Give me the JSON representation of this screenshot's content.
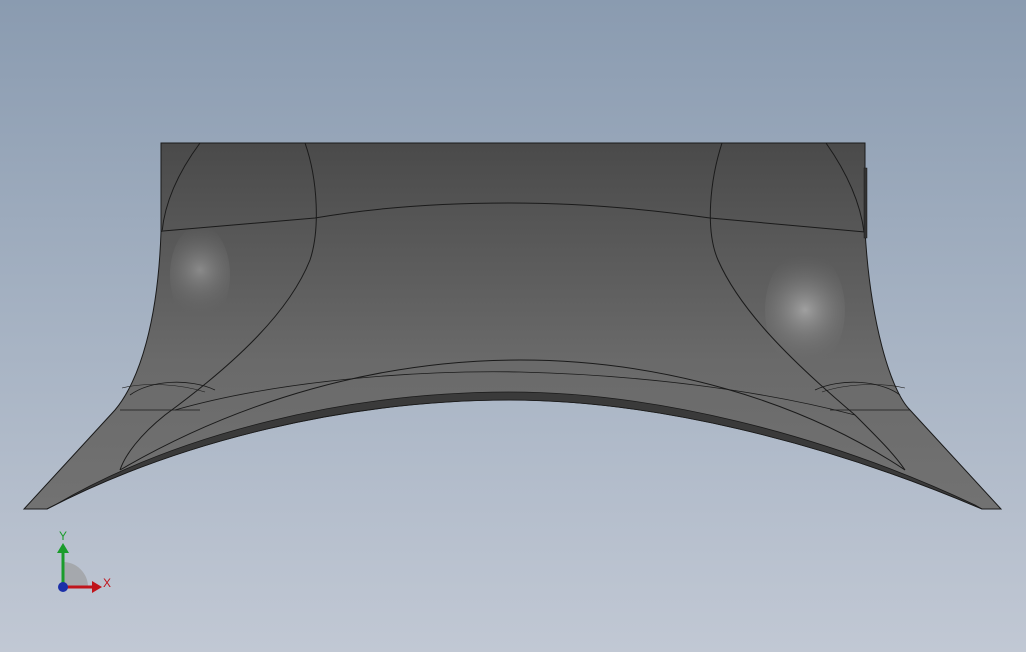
{
  "triad": {
    "x_label": "X",
    "y_label": "Y",
    "x_color": "#c0141b",
    "y_color": "#1a9c2b",
    "z_color": "#1b2fa8"
  },
  "colors": {
    "background_top": "#8a9bb0",
    "background_bottom": "#c1c8d4",
    "model_face": "#5c5c5c",
    "model_edge": "#1a1a1a"
  }
}
